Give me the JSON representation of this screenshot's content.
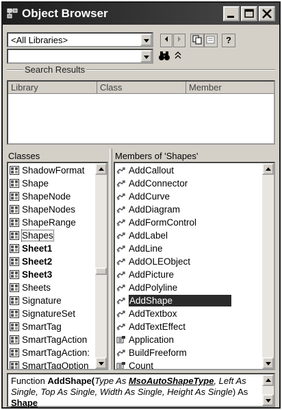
{
  "window": {
    "title": "Object Browser"
  },
  "toolbar": {
    "library_combo": "<All Libraries>",
    "search_combo": ""
  },
  "search_results": {
    "heading": "Search Results",
    "columns": [
      "Library",
      "Class",
      "Member"
    ]
  },
  "classes": {
    "heading": "Classes",
    "items": [
      {
        "label": "ShadowFormat",
        "bold": false
      },
      {
        "label": "Shape",
        "bold": false
      },
      {
        "label": "ShapeNode",
        "bold": false
      },
      {
        "label": "ShapeNodes",
        "bold": false
      },
      {
        "label": "ShapeRange",
        "bold": false
      },
      {
        "label": "Shapes",
        "bold": false,
        "focused": true
      },
      {
        "label": "Sheet1",
        "bold": true
      },
      {
        "label": "Sheet2",
        "bold": true
      },
      {
        "label": "Sheet3",
        "bold": true
      },
      {
        "label": "Sheets",
        "bold": false
      },
      {
        "label": "Signature",
        "bold": false
      },
      {
        "label": "SignatureSet",
        "bold": false
      },
      {
        "label": "SmartTag",
        "bold": false
      },
      {
        "label": "SmartTagAction",
        "bold": false
      },
      {
        "label": "SmartTagAction:",
        "bold": false
      },
      {
        "label": "SmartTagOption",
        "bold": false
      }
    ]
  },
  "members": {
    "heading": "Members of 'Shapes'",
    "items": [
      {
        "label": "AddCallout",
        "icon": "method-icon"
      },
      {
        "label": "AddConnector",
        "icon": "method-icon"
      },
      {
        "label": "AddCurve",
        "icon": "method-icon"
      },
      {
        "label": "AddDiagram",
        "icon": "method-icon"
      },
      {
        "label": "AddFormControl",
        "icon": "method-icon"
      },
      {
        "label": "AddLabel",
        "icon": "method-icon"
      },
      {
        "label": "AddLine",
        "icon": "method-icon"
      },
      {
        "label": "AddOLEObject",
        "icon": "method-icon"
      },
      {
        "label": "AddPicture",
        "icon": "method-icon"
      },
      {
        "label": "AddPolyline",
        "icon": "method-icon"
      },
      {
        "label": "AddShape",
        "icon": "method-icon",
        "selected": true
      },
      {
        "label": "AddTextbox",
        "icon": "method-icon"
      },
      {
        "label": "AddTextEffect",
        "icon": "method-icon"
      },
      {
        "label": "Application",
        "icon": "property-icon"
      },
      {
        "label": "BuildFreeform",
        "icon": "method-icon"
      },
      {
        "label": "Count",
        "icon": "property-icon"
      }
    ]
  },
  "details": {
    "p1": "Function ",
    "p2": "AddShape(",
    "p3": "Type As ",
    "p4": "MsoAutoShapeType",
    "p5": ", Left As Single, Top As Single, Width As Single, Height As Single",
    "p6": ") As ",
    "p7": "Shape"
  },
  "colors": {
    "selection": "#2a2a2a",
    "face": "#d4d0c8",
    "title": "#1e1e1e"
  }
}
